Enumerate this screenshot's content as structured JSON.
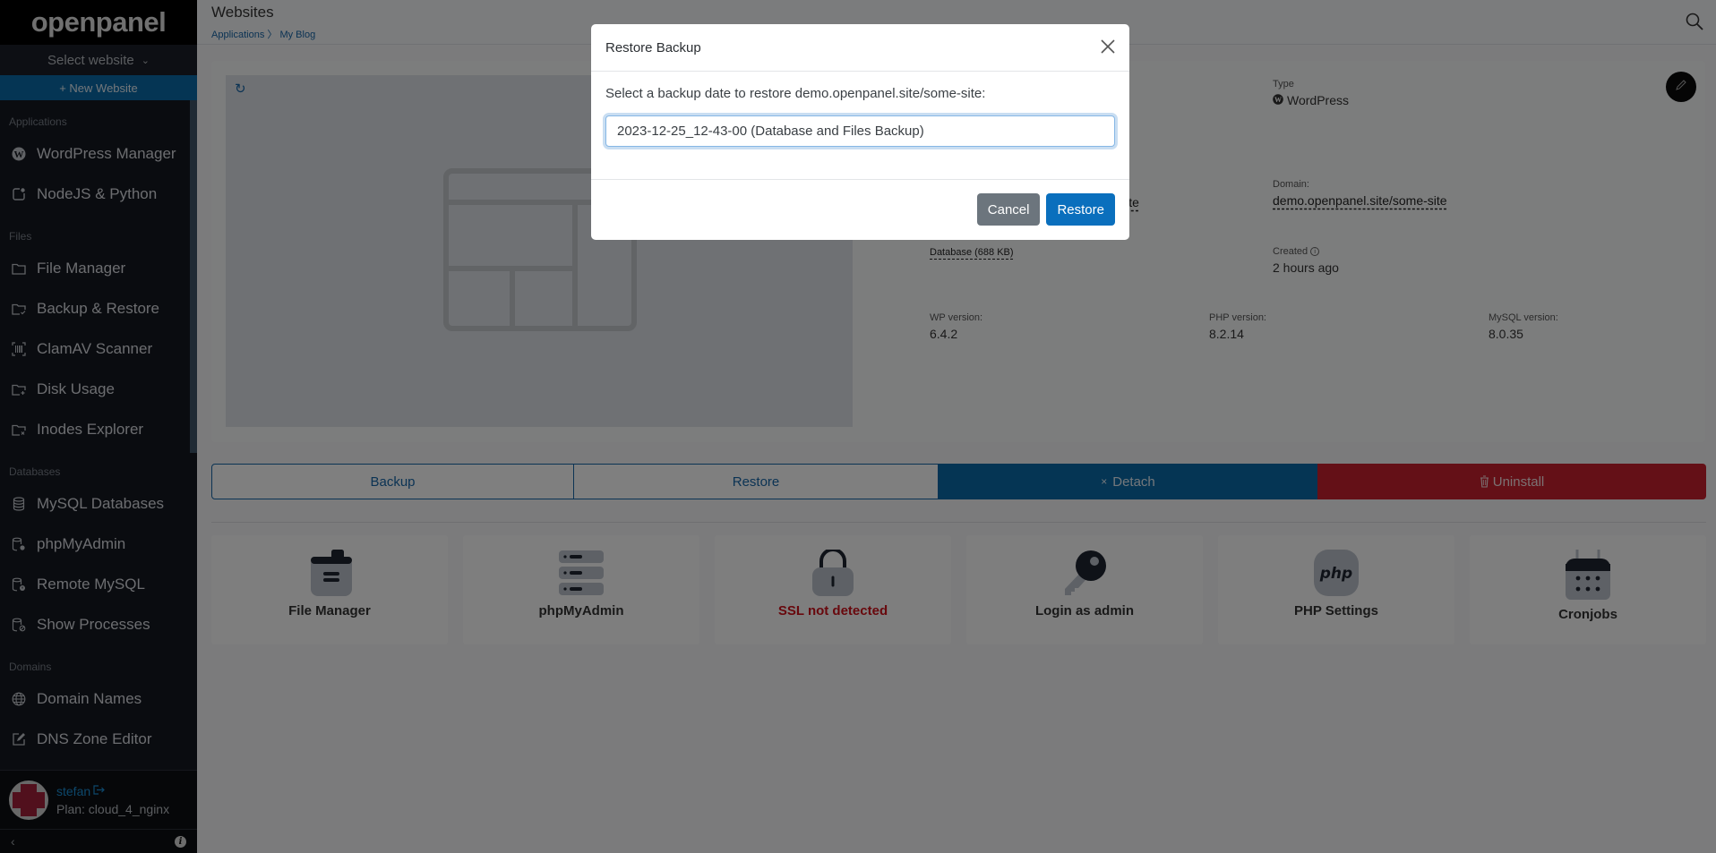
{
  "sidebar": {
    "brand": "openpanel",
    "select_website": "Select website",
    "new_website": "+ New Website",
    "sections": [
      {
        "title": "Applications",
        "items": [
          {
            "label": "WordPress Manager",
            "icon": "wordpress-icon"
          },
          {
            "label": "NodeJS & Python",
            "icon": "nodejs-icon"
          }
        ]
      },
      {
        "title": "Files",
        "items": [
          {
            "label": "File Manager",
            "icon": "folder-icon"
          },
          {
            "label": "Backup & Restore",
            "icon": "folder-check-icon"
          },
          {
            "label": "ClamAV Scanner",
            "icon": "barcode-scan-icon"
          },
          {
            "label": "Disk Usage",
            "icon": "folder-plus-icon"
          },
          {
            "label": "Inodes Explorer",
            "icon": "folder-x-icon"
          }
        ]
      },
      {
        "title": "Databases",
        "items": [
          {
            "label": "MySQL Databases",
            "icon": "database-icon"
          },
          {
            "label": "phpMyAdmin",
            "icon": "database-gear-icon"
          },
          {
            "label": "Remote MySQL",
            "icon": "database-alert-icon"
          },
          {
            "label": "Show Processes",
            "icon": "database-cancel-icon"
          }
        ]
      },
      {
        "title": "Domains",
        "items": [
          {
            "label": "Domain Names",
            "icon": "globe-icon"
          },
          {
            "label": "DNS Zone Editor",
            "icon": "edit-icon"
          }
        ]
      }
    ],
    "user": {
      "name": "stefan",
      "plan": "Plan: cloud_4_nginx"
    }
  },
  "header": {
    "title": "Websites",
    "breadcrumb": [
      "Applications",
      "My Blog"
    ],
    "breadcrumb_sep": "〉"
  },
  "site": {
    "type_label": "Type",
    "type_value": "WordPress",
    "domain_label": "Domain:",
    "domain_value": "demo.openpanel.site/some-site",
    "partial_link": "me-site",
    "database_link": "Database (688 KB)",
    "created_label": "Created",
    "created_value": "2 hours ago",
    "wp_version_label": "WP version:",
    "wp_version": "6.4.2",
    "php_version_label": "PHP version:",
    "php_version": "8.2.14",
    "mysql_version_label": "MySQL version:",
    "mysql_version": "8.0.35"
  },
  "actions": {
    "backup": "Backup",
    "restore": "Restore",
    "detach": "Detach",
    "detach_icon": "×",
    "uninstall": "Uninstall"
  },
  "tiles": [
    {
      "label": "File Manager",
      "icon": "file-manager-icon"
    },
    {
      "label": "phpMyAdmin",
      "icon": "server-icon"
    },
    {
      "label": "SSL not detected",
      "icon": "lock-icon",
      "status": "danger"
    },
    {
      "label": "Login as admin",
      "icon": "key-icon"
    },
    {
      "label": "PHP Settings",
      "icon": "php-icon"
    },
    {
      "label": "Cronjobs",
      "icon": "calendar-icon"
    }
  ],
  "modal": {
    "title": "Restore Backup",
    "prompt": "Select a backup date to restore demo.openpanel.site/some-site:",
    "selected_backup": "2023-12-25_12-43-00 (Database and Files Backup)",
    "cancel": "Cancel",
    "confirm": "Restore"
  },
  "colors": {
    "primary": "#0a6fbd",
    "danger": "#c8202f",
    "sidebar_bg": "#141820"
  }
}
